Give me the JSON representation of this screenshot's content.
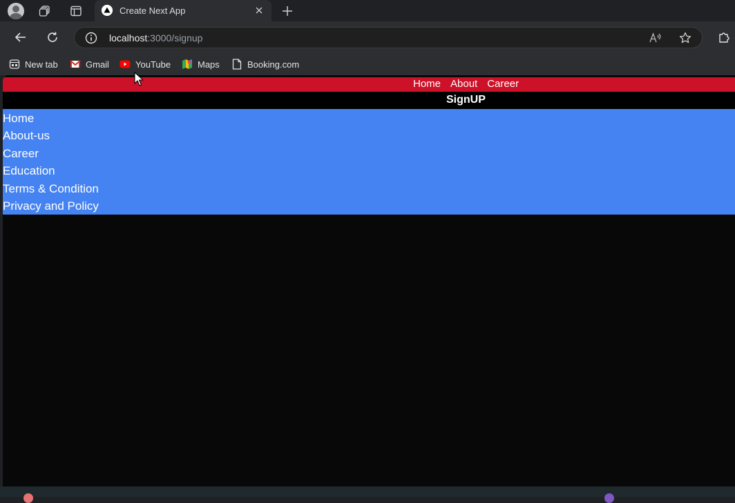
{
  "browser": {
    "tab": {
      "title": "Create Next App"
    },
    "address_bar": {
      "host": "localhost",
      "path": ":3000/signup"
    },
    "bookmarks": [
      {
        "label": "New tab",
        "icon": "new-tab-icon"
      },
      {
        "label": "Gmail",
        "icon": "gmail-icon"
      },
      {
        "label": "YouTube",
        "icon": "youtube-icon"
      },
      {
        "label": "Maps",
        "icon": "maps-icon"
      },
      {
        "label": "Booking.com",
        "icon": "page-icon"
      }
    ]
  },
  "page": {
    "nav": {
      "links": [
        "Home",
        "About",
        "Career"
      ],
      "background": "#cc1129"
    },
    "title": "SignUP",
    "menu": {
      "items": [
        "Home",
        "About-us",
        "Career",
        "Education",
        "Terms & Condition",
        "Privacy and Policy"
      ],
      "background": "#4583f2"
    },
    "background": "#080808"
  }
}
